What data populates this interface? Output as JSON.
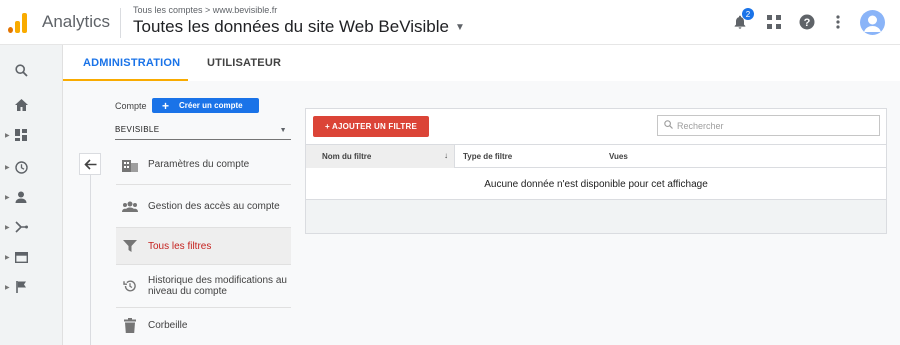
{
  "header": {
    "app_name": "Analytics",
    "breadcrumb": "Tous les comptes > www.bevisible.fr",
    "view_title": "Toutes les données du site Web BeVisible",
    "notification_count": "2"
  },
  "tabs": [
    {
      "label": "ADMINISTRATION",
      "active": true
    },
    {
      "label": "UTILISATEUR",
      "active": false
    }
  ],
  "account": {
    "label": "Compte",
    "create_button": "Créer un compte",
    "selected_account": "BEVISIBLE"
  },
  "menu": [
    {
      "label": "Paramètres du compte",
      "icon": "building-icon",
      "selected": false
    },
    {
      "label": "Gestion des accès au compte",
      "icon": "people-icon",
      "selected": false
    },
    {
      "label": "Tous les filtres",
      "icon": "filter-icon",
      "selected": true
    },
    {
      "label": "Historique des modifications au niveau du compte",
      "icon": "history-icon",
      "selected": false
    },
    {
      "label": "Corbeille",
      "icon": "trash-icon",
      "selected": false
    }
  ],
  "filters": {
    "add_button": "+ AJOUTER UN FILTRE",
    "search_placeholder": "Rechercher",
    "columns": [
      "Nom du filtre",
      "Type de filtre",
      "Vues"
    ],
    "empty_message": "Aucune donnée n'est disponible pour cet affichage"
  },
  "rail_icons": [
    "search-icon",
    "home-icon",
    "dashboard-icon",
    "clock-icon",
    "person-icon",
    "acquisition-icon",
    "behavior-icon",
    "flag-icon"
  ],
  "colors": {
    "accent": "#1a73e8",
    "tab_indicator": "#f9ab00",
    "add_filter": "#db4437",
    "selected_menu_text": "#c5221f",
    "logo_orange": "#f9ab00",
    "logo_dark_orange": "#e37400"
  }
}
